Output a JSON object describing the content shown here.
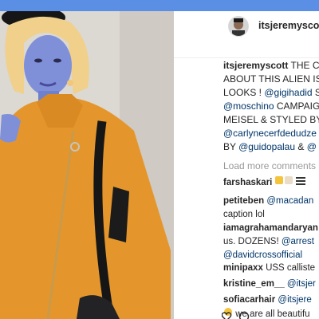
{
  "post": {
    "username": "itsjeremyscott",
    "caption_lines": [
      "THE C",
      "ABOUT THIS ALIEN IS",
      "LOOKS ! ",
      "@moschino",
      "MEISEL & STYLED BY",
      "@carlynecerfdedudze",
      "BY "
    ],
    "caption_parts": {
      "mention_gigihadid": "@gigihadid",
      "after_gigi": " S",
      "campaign_word": " CAMPAIG",
      "mention_guidopalau": "@guidopalau",
      "amp": " & "
    },
    "load_more": "Load more comments"
  },
  "comments": [
    {
      "user": "farshaskari",
      "text": ""
    },
    {
      "user": "petiteben",
      "text": "@macadan",
      "line2": "caption lol"
    },
    {
      "user": "iamagrahamandaryan",
      "text": "",
      "line2_prefix": "us. DOZENS! ",
      "line2_mention": "@arrest",
      "line3": "@davidcrossofficial"
    },
    {
      "user": "minipaxx",
      "text": "USS calliste"
    },
    {
      "user": "kristine_em__",
      "text": "@itsjer"
    },
    {
      "user": "sofiacarhair",
      "text": "@itsjere",
      "line2": "we are all beautifu"
    }
  ],
  "colors": {
    "topbar": "#5b8fe6",
    "mention": "#003569",
    "coat": "#e4962c",
    "skin": "#7d8fd8",
    "hair": "#f2d48a"
  },
  "icons": [
    "avatar",
    "raised-hands-emoji",
    "clapping-hands-emoji",
    "heart-icon",
    "comment-icon"
  ]
}
